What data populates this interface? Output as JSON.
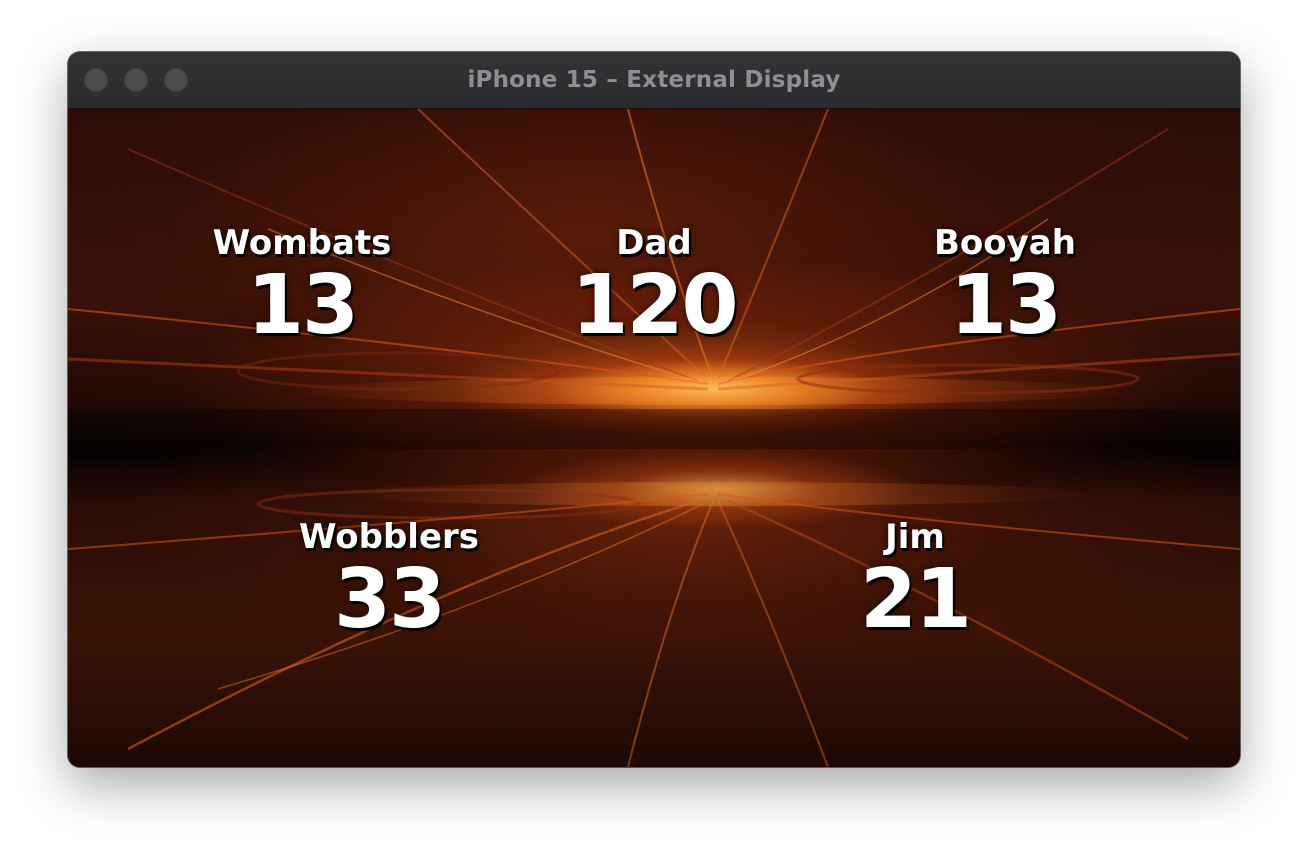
{
  "window": {
    "title": "iPhone 15 – External Display"
  },
  "theme": {
    "text_color": "#ffffff",
    "titlebar_color": "#2f2f32"
  },
  "players": [
    {
      "name": "Wombats",
      "score": "13"
    },
    {
      "name": "Dad",
      "score": "120"
    },
    {
      "name": "Booyah",
      "score": "13"
    },
    {
      "name": "Wobblers",
      "score": "33"
    },
    {
      "name": "Jim",
      "score": "21"
    }
  ]
}
